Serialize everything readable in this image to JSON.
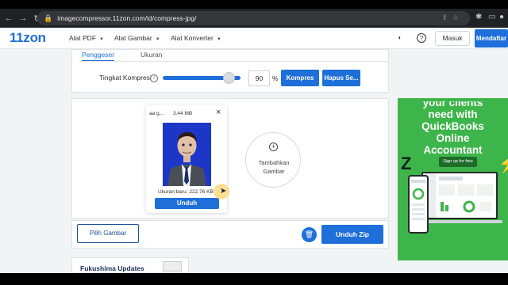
{
  "browser": {
    "url": "imagecompressor.11zon.com/id/compress-jpg/"
  },
  "header": {
    "logo": "11zon",
    "menu": [
      {
        "label": "Alat PDF"
      },
      {
        "label": "Alat Gambar"
      },
      {
        "label": "Alat Konverter"
      }
    ],
    "masuk": "Masuk",
    "mendaftar": "Mendaftar"
  },
  "settings": {
    "tabs": [
      "Penggeser",
      "Ukuran"
    ],
    "compression_label": "Tingkat Kompresi",
    "compression_value": "90",
    "percent_sign": "%",
    "compress_button": "Kompres",
    "clear_button": "Hapus Se..."
  },
  "file_card": {
    "name": "aa g...",
    "size": "3.44 MB",
    "close": "×",
    "new_size": "Ukuran baru: 222.76 KB",
    "download": "Unduh"
  },
  "add_image": {
    "plus": "+",
    "label_line1": "Tambahkan",
    "label_line2": "Gambar"
  },
  "actions": {
    "choose_image": "Pilih Gambar",
    "download_zip": "Unduh Zip"
  },
  "ad_strip": {
    "text": "Fukushima Updates"
  },
  "ad": {
    "cut_line": "your clients",
    "line1": "need with",
    "line2": "QuickBooks",
    "line3": "Online",
    "line4": "Accountant",
    "cta": "Sign up for free"
  },
  "colors": {
    "brand_blue": "#1e6fd9",
    "ad_green": "#3db54a"
  }
}
